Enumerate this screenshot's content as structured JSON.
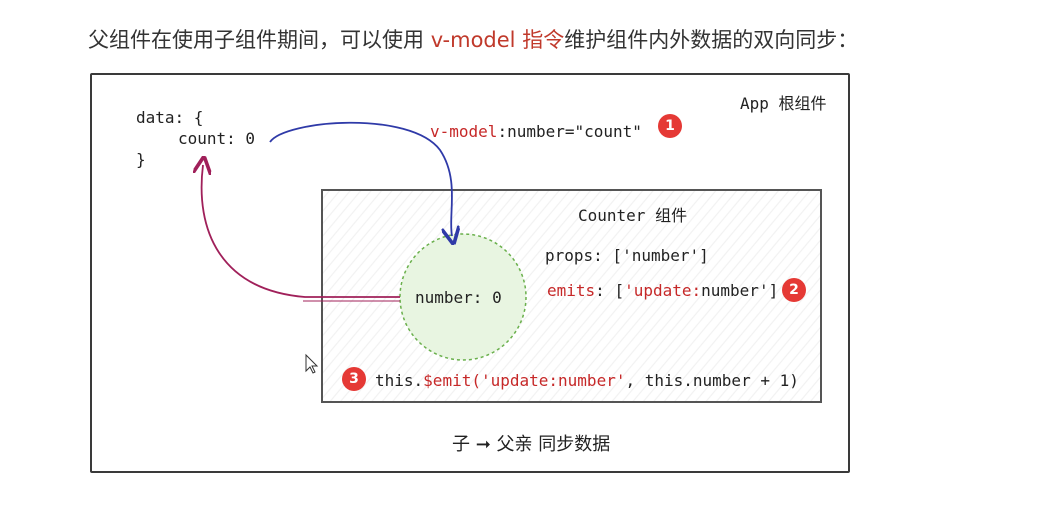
{
  "heading": {
    "prefix": "父组件在使用子组件期间，可以使用 ",
    "accent": "v-model 指令",
    "suffix": "维护组件内外数据的双向同步："
  },
  "app": {
    "title": "App 根组件",
    "data_open": "data: {",
    "data_field": "count: 0",
    "data_close": "}",
    "vmodel_directive": "v-model",
    "vmodel_rest": ":number=\"count\""
  },
  "counter": {
    "title": "Counter 组件",
    "props_line": "props: ['number']",
    "emits_key": "emits",
    "emits_colon": ": [",
    "emits_value": "'update:",
    "emits_rest": "number']",
    "state": "number: 0",
    "emit_prefix": "this.",
    "emit_call": "$emit(",
    "emit_event": "'update:number'",
    "emit_rest": ", this.number + 1)"
  },
  "badges": [
    "1",
    "2",
    "3"
  ],
  "caption": "子 ➞ 父亲 同步数据",
  "colors": {
    "accent": "#c0392b",
    "badge": "#e53935",
    "arrow_down": "#2f3aa8",
    "arrow_up": "#a0205a",
    "circle": "#6ab04c"
  },
  "icons": [
    "mouse-cursor-icon"
  ]
}
